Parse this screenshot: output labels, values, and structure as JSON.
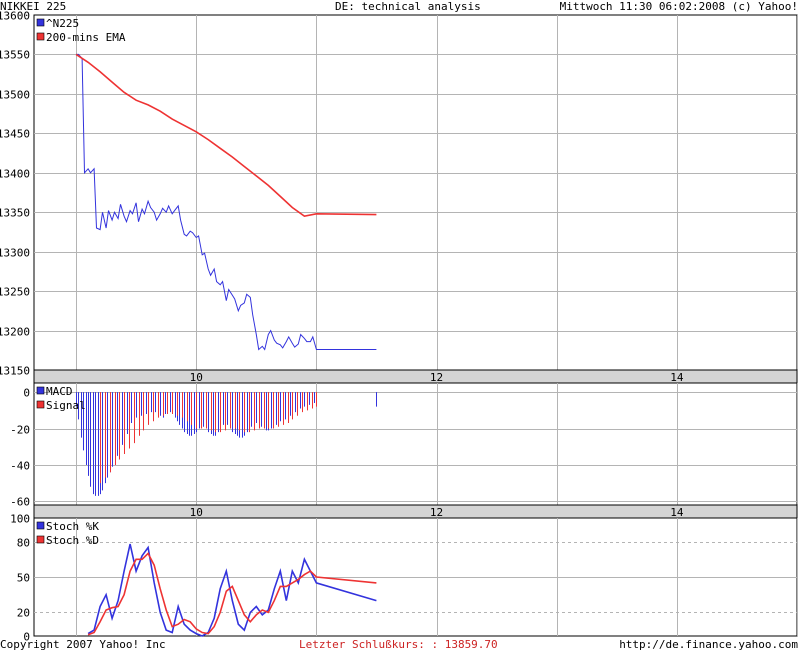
{
  "header": {
    "left": "NIKKEI 225",
    "center": "DE: technical analysis",
    "right": "Mittwoch 11:30 06:02:2008 (c) Yahoo!"
  },
  "footer": {
    "left": "Copyright 2007 Yahoo! Inc",
    "center": "Letzter Schlußkurs: : 13859.70",
    "right": "http://de.finance.yahoo.com"
  },
  "colors": {
    "series_blue": "#3333dd",
    "series_red": "#ee3333",
    "grid": "#b4b4b4",
    "axis_band": "#d4d4d4",
    "footer_center": "#cc2222"
  },
  "x_axis_ticks": [
    "10",
    "12",
    "14"
  ],
  "chart_data": [
    {
      "type": "line",
      "ylim": [
        13150,
        13600
      ],
      "y_ticks": [
        13150,
        13200,
        13250,
        13300,
        13350,
        13400,
        13450,
        13500,
        13550,
        13600
      ],
      "x_tick_labels": [
        "10",
        "12",
        "14"
      ],
      "grid": true,
      "legend_position": "top-left",
      "series": [
        {
          "name": "^N225",
          "color": "#3333dd",
          "x": [
            9.0,
            9.02,
            9.05,
            9.07,
            9.1,
            9.12,
            9.15,
            9.17,
            9.2,
            9.22,
            9.25,
            9.27,
            9.3,
            9.32,
            9.35,
            9.37,
            9.4,
            9.42,
            9.45,
            9.47,
            9.5,
            9.52,
            9.55,
            9.57,
            9.6,
            9.62,
            9.65,
            9.67,
            9.7,
            9.72,
            9.75,
            9.77,
            9.8,
            9.82,
            9.85,
            9.87,
            9.9,
            9.92,
            9.95,
            9.97,
            10.0,
            10.02,
            10.05,
            10.07,
            10.1,
            10.12,
            10.15,
            10.17,
            10.2,
            10.22,
            10.25,
            10.27,
            10.3,
            10.32,
            10.35,
            10.37,
            10.4,
            10.42,
            10.45,
            10.47,
            10.5,
            10.52,
            10.55,
            10.57,
            10.6,
            10.62,
            10.65,
            10.67,
            10.7,
            10.72,
            10.75,
            10.77,
            10.8,
            10.82,
            10.85,
            10.87,
            10.9,
            10.92,
            10.95,
            10.97,
            11.0,
            11.5
          ],
          "values": [
            13550,
            13550,
            13545,
            13400,
            13405,
            13400,
            13405,
            13330,
            13328,
            13350,
            13330,
            13352,
            13340,
            13350,
            13342,
            13360,
            13345,
            13338,
            13352,
            13348,
            13362,
            13338,
            13354,
            13348,
            13364,
            13356,
            13350,
            13340,
            13348,
            13355,
            13350,
            13358,
            13348,
            13352,
            13358,
            13340,
            13322,
            13320,
            13326,
            13324,
            13318,
            13320,
            13296,
            13298,
            13278,
            13270,
            13278,
            13262,
            13258,
            13262,
            13238,
            13252,
            13245,
            13240,
            13225,
            13232,
            13235,
            13246,
            13242,
            13220,
            13195,
            13176,
            13180,
            13176,
            13195,
            13200,
            13188,
            13184,
            13182,
            13178,
            13186,
            13192,
            13184,
            13179,
            13183,
            13195,
            13190,
            13186,
            13186,
            13192,
            13176,
            13176
          ]
        },
        {
          "name": "200-mins EMA",
          "color": "#ee3333",
          "x": [
            9.0,
            9.1,
            9.2,
            9.3,
            9.4,
            9.5,
            9.6,
            9.7,
            9.8,
            9.9,
            10.0,
            10.1,
            10.2,
            10.3,
            10.4,
            10.5,
            10.6,
            10.7,
            10.8,
            10.9,
            11.0,
            11.5
          ],
          "values": [
            13550,
            13540,
            13528,
            13515,
            13502,
            13492,
            13486,
            13478,
            13468,
            13460,
            13452,
            13442,
            13431,
            13420,
            13408,
            13396,
            13384,
            13370,
            13356,
            13345,
            13348,
            13347
          ]
        }
      ]
    },
    {
      "type": "bar",
      "ylim": [
        -62,
        5
      ],
      "y_ticks": [
        -60,
        -40,
        -20,
        0
      ],
      "x_tick_labels": [
        "10",
        "12",
        "14"
      ],
      "grid": true,
      "legend_position": "top-left",
      "series": [
        {
          "name": "MACD",
          "color": "#3333dd",
          "x": [
            9.0,
            9.02,
            9.04,
            9.06,
            9.08,
            9.1,
            9.12,
            9.14,
            9.16,
            9.18,
            9.2,
            9.22,
            9.24,
            9.26,
            9.28,
            9.3,
            9.32,
            9.34,
            9.36,
            9.38,
            9.4,
            9.42,
            9.44,
            9.46,
            9.48,
            9.5,
            9.52,
            9.54,
            9.56,
            9.58,
            9.6,
            9.62,
            9.64,
            9.66,
            9.68,
            9.7,
            9.72,
            9.74,
            9.76,
            9.78,
            9.8,
            9.82,
            9.84,
            9.86,
            9.88,
            9.9,
            9.92,
            9.94,
            9.96,
            9.98,
            10.0,
            10.02,
            10.04,
            10.06,
            10.08,
            10.1,
            10.12,
            10.14,
            10.16,
            10.18,
            10.2,
            10.22,
            10.24,
            10.26,
            10.28,
            10.3,
            10.32,
            10.34,
            10.36,
            10.38,
            10.4,
            10.42,
            10.44,
            10.46,
            10.48,
            10.5,
            10.52,
            10.54,
            10.56,
            10.58,
            10.6,
            10.62,
            10.64,
            10.66,
            10.68,
            10.7,
            10.72,
            10.74,
            10.76,
            10.78,
            10.8,
            10.82,
            10.84,
            10.86,
            10.88,
            10.9,
            10.92,
            10.94,
            10.96,
            10.98,
            11.5
          ],
          "values": [
            -8,
            -15,
            -25,
            -32,
            -40,
            -46,
            -52,
            -56,
            -57,
            -57,
            -56,
            -54,
            -50,
            -47,
            -44,
            -41,
            -38,
            -35,
            -32,
            -29,
            -26,
            -23,
            -20,
            -17,
            -15,
            -14,
            -14,
            -13,
            -12,
            -12,
            -11,
            -11,
            -11,
            -11,
            -12,
            -13,
            -14,
            -12,
            -11,
            -11,
            -12,
            -14,
            -16,
            -18,
            -20,
            -22,
            -23,
            -24,
            -24,
            -23,
            -22,
            -20,
            -18,
            -19,
            -20,
            -22,
            -23,
            -24,
            -24,
            -22,
            -20,
            -18,
            -17,
            -18,
            -20,
            -22,
            -23,
            -24,
            -25,
            -25,
            -24,
            -22,
            -20,
            -19,
            -18,
            -17,
            -18,
            -19,
            -20,
            -21,
            -21,
            -20,
            -19,
            -18,
            -17,
            -16,
            -15,
            -15,
            -14,
            -13,
            -12,
            -11,
            -10,
            -9,
            -8,
            -8,
            -7,
            -7,
            -6,
            -6,
            -8
          ]
        },
        {
          "name": "Signal",
          "color": "#ee3333",
          "x": [
            9.2,
            9.24,
            9.28,
            9.32,
            9.36,
            9.4,
            9.44,
            9.48,
            9.52,
            9.56,
            9.6,
            9.64,
            9.68,
            9.72,
            9.76,
            9.8,
            9.84,
            9.88,
            9.92,
            9.96,
            10.0,
            10.04,
            10.08,
            10.12,
            10.16,
            10.2,
            10.24,
            10.28,
            10.32,
            10.36,
            10.4,
            10.44,
            10.48,
            10.52,
            10.56,
            10.6,
            10.64,
            10.68,
            10.72,
            10.76,
            10.8,
            10.84,
            10.88,
            10.92,
            10.96,
            11.0
          ],
          "values": [
            -50,
            -47,
            -44,
            -40,
            -37,
            -34,
            -31,
            -28,
            -24,
            -21,
            -18,
            -16,
            -14,
            -13,
            -12,
            -12,
            -13,
            -14,
            -16,
            -18,
            -20,
            -20,
            -20,
            -21,
            -22,
            -22,
            -21,
            -20,
            -20,
            -21,
            -22,
            -22,
            -21,
            -20,
            -20,
            -20,
            -20,
            -19,
            -18,
            -17,
            -15,
            -13,
            -11,
            -10,
            -9,
            -8
          ]
        }
      ]
    },
    {
      "type": "line",
      "ylim": [
        0,
        100
      ],
      "y_ticks": [
        0,
        20,
        50,
        80,
        100
      ],
      "x_tick_labels": [
        "10",
        "12",
        "14"
      ],
      "grid": true,
      "legend_position": "top-left",
      "series": [
        {
          "name": "Stoch %K",
          "color": "#3333dd",
          "x": [
            9.1,
            9.15,
            9.2,
            9.25,
            9.3,
            9.35,
            9.4,
            9.45,
            9.5,
            9.55,
            9.6,
            9.65,
            9.7,
            9.75,
            9.8,
            9.85,
            9.9,
            9.95,
            10.0,
            10.05,
            10.1,
            10.15,
            10.2,
            10.25,
            10.3,
            10.35,
            10.4,
            10.45,
            10.5,
            10.55,
            10.6,
            10.65,
            10.7,
            10.75,
            10.8,
            10.85,
            10.9,
            10.95,
            11.0,
            11.5
          ],
          "values": [
            2,
            5,
            25,
            35,
            15,
            30,
            55,
            78,
            55,
            68,
            75,
            45,
            20,
            5,
            3,
            25,
            10,
            5,
            2,
            0,
            3,
            15,
            40,
            55,
            30,
            10,
            5,
            20,
            25,
            18,
            22,
            40,
            55,
            30,
            55,
            45,
            65,
            55,
            45,
            30
          ]
        },
        {
          "name": "Stoch %D",
          "color": "#ee3333",
          "x": [
            9.1,
            9.15,
            9.2,
            9.25,
            9.3,
            9.35,
            9.4,
            9.45,
            9.5,
            9.55,
            9.6,
            9.65,
            9.7,
            9.75,
            9.8,
            9.85,
            9.9,
            9.95,
            10.0,
            10.05,
            10.1,
            10.15,
            10.2,
            10.25,
            10.3,
            10.35,
            10.4,
            10.45,
            10.5,
            10.55,
            10.6,
            10.65,
            10.7,
            10.75,
            10.8,
            10.85,
            10.9,
            10.95,
            11.0,
            11.5
          ],
          "values": [
            1,
            3,
            12,
            22,
            24,
            25,
            35,
            55,
            65,
            65,
            70,
            60,
            40,
            22,
            8,
            10,
            14,
            12,
            6,
            3,
            2,
            8,
            20,
            38,
            42,
            30,
            18,
            12,
            18,
            22,
            20,
            30,
            42,
            42,
            45,
            48,
            52,
            55,
            50,
            45
          ]
        }
      ]
    }
  ]
}
